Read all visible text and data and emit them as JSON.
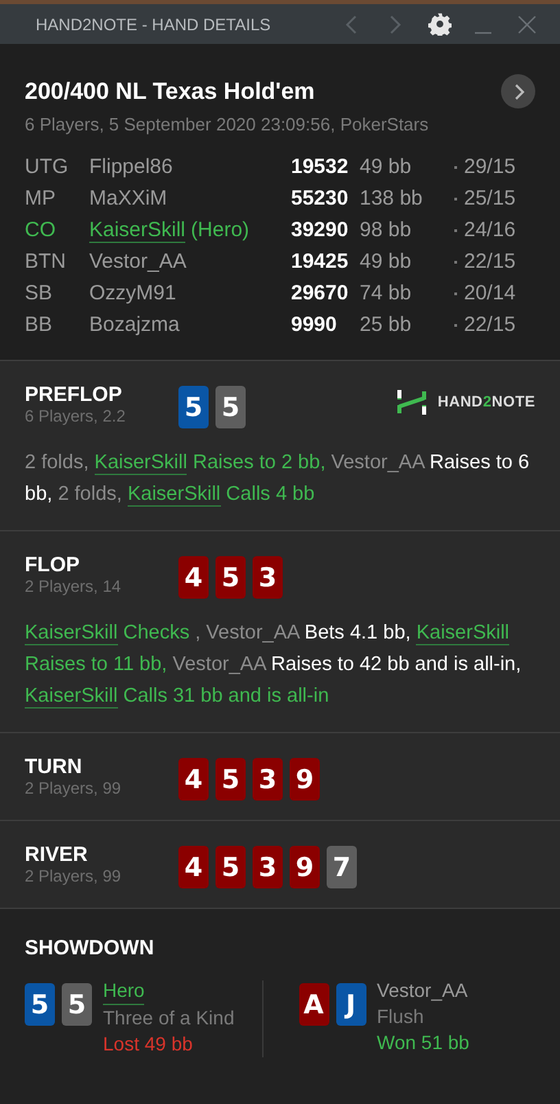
{
  "window": {
    "title": "HAND2NOTE - HAND DETAILS",
    "back_disabled": true,
    "forward_disabled": true
  },
  "header": {
    "title": "200/400 NL Texas Hold'em",
    "subtitle": "6 Players, 5 September 2020 23:09:56, PokerStars"
  },
  "players": [
    {
      "position": "UTG",
      "name": "Flippel86",
      "hero": false,
      "stack": "19532",
      "bb": "49 bb",
      "stat": "29/15"
    },
    {
      "position": "MP",
      "name": "MaXXiM",
      "hero": false,
      "stack": "55230",
      "bb": "138 bb",
      "stat": "25/15"
    },
    {
      "position": "CO",
      "name": "KaiserSkill",
      "hero": true,
      "tag": "(Hero)",
      "stack": "39290",
      "bb": "98 bb",
      "stat": "24/16"
    },
    {
      "position": "BTN",
      "name": "Vestor_AA",
      "hero": false,
      "stack": "19425",
      "bb": "49 bb",
      "stat": "22/15"
    },
    {
      "position": "SB",
      "name": "OzzyM91",
      "hero": false,
      "stack": "29670",
      "bb": "74 bb",
      "stat": "20/14"
    },
    {
      "position": "BB",
      "name": "Bozajzma",
      "hero": false,
      "stack": "9990",
      "bb": "25 bb",
      "stat": "22/15"
    }
  ],
  "logo": [
    {
      "text": "HAND",
      "accent": false
    },
    {
      "text": "2",
      "accent": true
    },
    {
      "text": "NOTE",
      "accent": false
    }
  ],
  "streets": [
    {
      "name": "PREFLOP",
      "info": "6 Players, 2.2",
      "logo": true,
      "cards": [
        {
          "rank": "5",
          "color": "#0a56a6"
        },
        {
          "rank": "5",
          "color": "#5e5e5e"
        }
      ],
      "actions": [
        {
          "text": "2 folds, ",
          "kind": "fold"
        },
        {
          "text": "KaiserSkill",
          "kind": "hero-name"
        },
        {
          "text": " Raises to 2 bb, ",
          "kind": "hero-action"
        },
        {
          "text": "Vestor_AA",
          "kind": "name"
        },
        {
          "text": " Raises to 6 bb, ",
          "kind": "action"
        },
        {
          "text": "2 folds, ",
          "kind": "fold"
        },
        {
          "text": "KaiserSkill",
          "kind": "hero-name"
        },
        {
          "text": " Calls 4 bb",
          "kind": "hero-action"
        }
      ]
    },
    {
      "name": "FLOP",
      "info": "2 Players, 14",
      "logo": false,
      "cards": [
        {
          "rank": "4",
          "color": "#8b0000"
        },
        {
          "rank": "5",
          "color": "#8b0000"
        },
        {
          "rank": "3",
          "color": "#8b0000"
        }
      ],
      "actions": [
        {
          "text": "KaiserSkill",
          "kind": "hero-name"
        },
        {
          "text": " Checks ",
          "kind": "hero-action"
        },
        {
          "text": ", ",
          "kind": "fold"
        },
        {
          "text": "Vestor_AA",
          "kind": "name"
        },
        {
          "text": " Bets 4.1 bb, ",
          "kind": "action"
        },
        {
          "text": "KaiserSkill",
          "kind": "hero-name"
        },
        {
          "text": " Raises to 11 bb, ",
          "kind": "hero-action"
        },
        {
          "text": "Vestor_AA",
          "kind": "name"
        },
        {
          "text": " Raises to 42 bb and is all-in, ",
          "kind": "action"
        },
        {
          "text": "KaiserSkill",
          "kind": "hero-name"
        },
        {
          "text": " Calls 31 bb and is all-in",
          "kind": "hero-action"
        }
      ]
    },
    {
      "name": "TURN",
      "info": "2 Players, 99",
      "logo": false,
      "cards": [
        {
          "rank": "4",
          "color": "#8b0000"
        },
        {
          "rank": "5",
          "color": "#8b0000"
        },
        {
          "rank": "3",
          "color": "#8b0000"
        },
        {
          "rank": "9",
          "color": "#8b0000"
        }
      ]
    },
    {
      "name": "RIVER",
      "info": "2 Players, 99",
      "logo": false,
      "cards": [
        {
          "rank": "4",
          "color": "#8b0000"
        },
        {
          "rank": "5",
          "color": "#8b0000"
        },
        {
          "rank": "3",
          "color": "#8b0000"
        },
        {
          "rank": "9",
          "color": "#8b0000"
        },
        {
          "rank": "7",
          "color": "#5e5e5e"
        }
      ]
    }
  ],
  "showdown": {
    "title": "SHOWDOWN",
    "hands": [
      {
        "cards": [
          {
            "rank": "5",
            "color": "#0a56a6"
          },
          {
            "rank": "5",
            "color": "#5e5e5e"
          }
        ],
        "name": "Hero",
        "hero": true,
        "hand": "Three of a Kind",
        "result": "Lost 49 bb",
        "won": false
      },
      {
        "cards": [
          {
            "rank": "A",
            "color": "#8b0000"
          },
          {
            "rank": "J",
            "color": "#0a56a6"
          }
        ],
        "name": "Vestor_AA",
        "hero": false,
        "hand": "Flush",
        "result": "Won 51 bb",
        "won": true
      }
    ]
  }
}
